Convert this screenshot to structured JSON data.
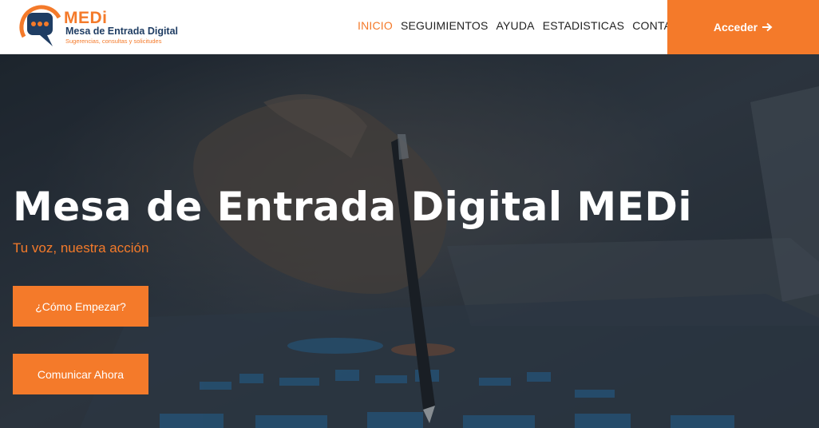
{
  "brand": {
    "name": "MEDi",
    "subtitle": "Mesa de Entrada Digital",
    "tagline": "Sugerencias, consultas y solicitudes"
  },
  "nav": [
    {
      "label": "INICIO",
      "active": true
    },
    {
      "label": "SEGUIMIENTOS",
      "active": false
    },
    {
      "label": "AYUDA",
      "active": false
    },
    {
      "label": "ESTADISTICAS",
      "active": false
    },
    {
      "label": "CONTACTO",
      "active": false
    }
  ],
  "login": {
    "label": "Acceder",
    "icon": "arrow-right-icon"
  },
  "hero": {
    "title": "Mesa de Entrada Digital MEDi",
    "subtitle": "Tu voz, nuestra acción",
    "start_button": "¿Cómo Empezar?",
    "communicate_button": "Comunicar Ahora"
  },
  "colors": {
    "accent": "#f47a2a",
    "navy": "#1f3d63"
  }
}
